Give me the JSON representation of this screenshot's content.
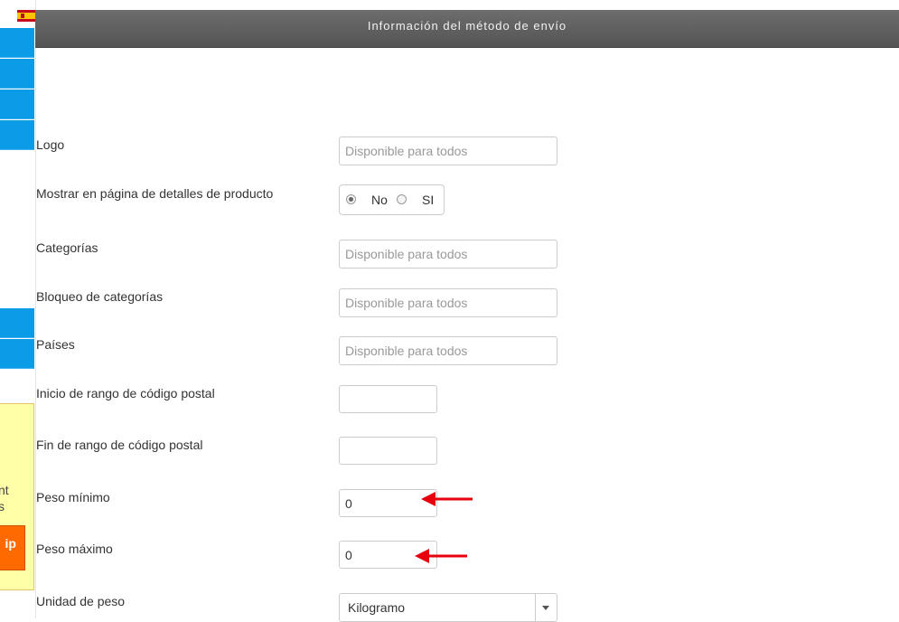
{
  "header": {
    "title": "Información del método de envío"
  },
  "language_flag": {
    "icon": "spain-flag-icon"
  },
  "promo": {
    "line1": "nt",
    "line2": "s",
    "button_label": "ip"
  },
  "form": {
    "logo": {
      "label": "Logo",
      "placeholder": "Disponible para todos"
    },
    "show_on_product_page": {
      "label": "Mostrar en página de detalles de producto",
      "options": [
        "No",
        "SI"
      ],
      "selected": "No"
    },
    "categories": {
      "label": "Categorías",
      "placeholder": "Disponible para todos"
    },
    "category_block": {
      "label": "Bloqueo de categorías",
      "placeholder": "Disponible para todos"
    },
    "countries": {
      "label": "Países",
      "placeholder": "Disponible para todos"
    },
    "zip_start": {
      "label": "Inicio de rango de código postal",
      "value": ""
    },
    "zip_end": {
      "label": "Fin de rango de código postal",
      "value": ""
    },
    "weight_min": {
      "label": "Peso mínimo",
      "value": "0"
    },
    "weight_max": {
      "label": "Peso máximo",
      "value": "0"
    },
    "weight_unit": {
      "label": "Unidad de peso",
      "selected": "Kilogramo"
    }
  },
  "annotation": {
    "arrow_color": "#e8000d"
  },
  "colors": {
    "nav_blue": "#0c9be6",
    "header_gray": "#5e5e5e",
    "promo_yellow": "#ffffa8",
    "promo_orange": "#ff6a00"
  }
}
